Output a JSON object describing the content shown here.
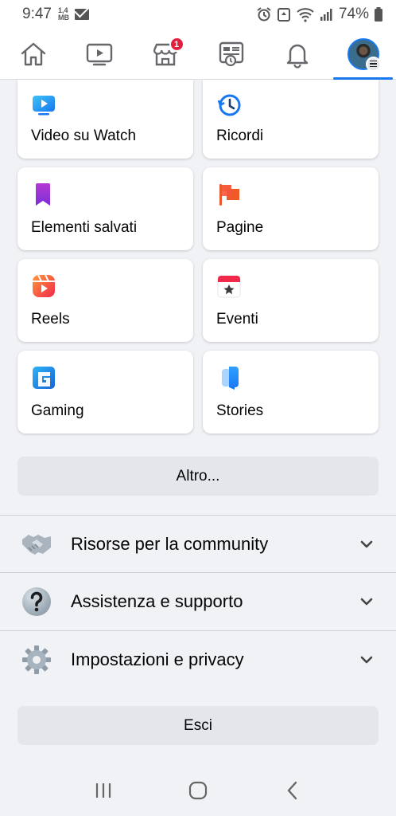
{
  "status_bar": {
    "time": "9:47",
    "data_rate_value": "1,4",
    "data_rate_unit": "MB",
    "battery": "74%"
  },
  "top_nav": {
    "items": [
      {
        "name": "home",
        "icon": "home-icon"
      },
      {
        "name": "watch",
        "icon": "video-play-icon"
      },
      {
        "name": "marketplace",
        "icon": "marketplace-store-icon",
        "badge": "1"
      },
      {
        "name": "news",
        "icon": "news-feed-icon"
      },
      {
        "name": "notifications",
        "icon": "bell-icon"
      },
      {
        "name": "menu",
        "icon": "profile-menu-avatar",
        "active": true
      }
    ],
    "accent_color": "#1877f2",
    "badge_color": "#e41e3f"
  },
  "shortcuts": [
    {
      "label": "Video su Watch",
      "icon": "watch-video-icon"
    },
    {
      "label": "Ricordi",
      "icon": "memories-clock-icon"
    },
    {
      "label": "Elementi salvati",
      "icon": "saved-bookmark-icon"
    },
    {
      "label": "Pagine",
      "icon": "pages-flag-icon"
    },
    {
      "label": "Reels",
      "icon": "reels-icon"
    },
    {
      "label": "Eventi",
      "icon": "events-calendar-icon"
    },
    {
      "label": "Gaming",
      "icon": "gaming-icon"
    },
    {
      "label": "Stories",
      "icon": "stories-icon"
    }
  ],
  "more_button": "Altro...",
  "sections": [
    {
      "label": "Risorse per la community",
      "icon": "handshake-icon"
    },
    {
      "label": "Assistenza e supporto",
      "icon": "question-mark-icon"
    },
    {
      "label": "Impostazioni e privacy",
      "icon": "gear-icon"
    }
  ],
  "logout_button": "Esci",
  "system_nav": [
    "recent-apps-icon",
    "home-button-icon",
    "back-icon"
  ]
}
